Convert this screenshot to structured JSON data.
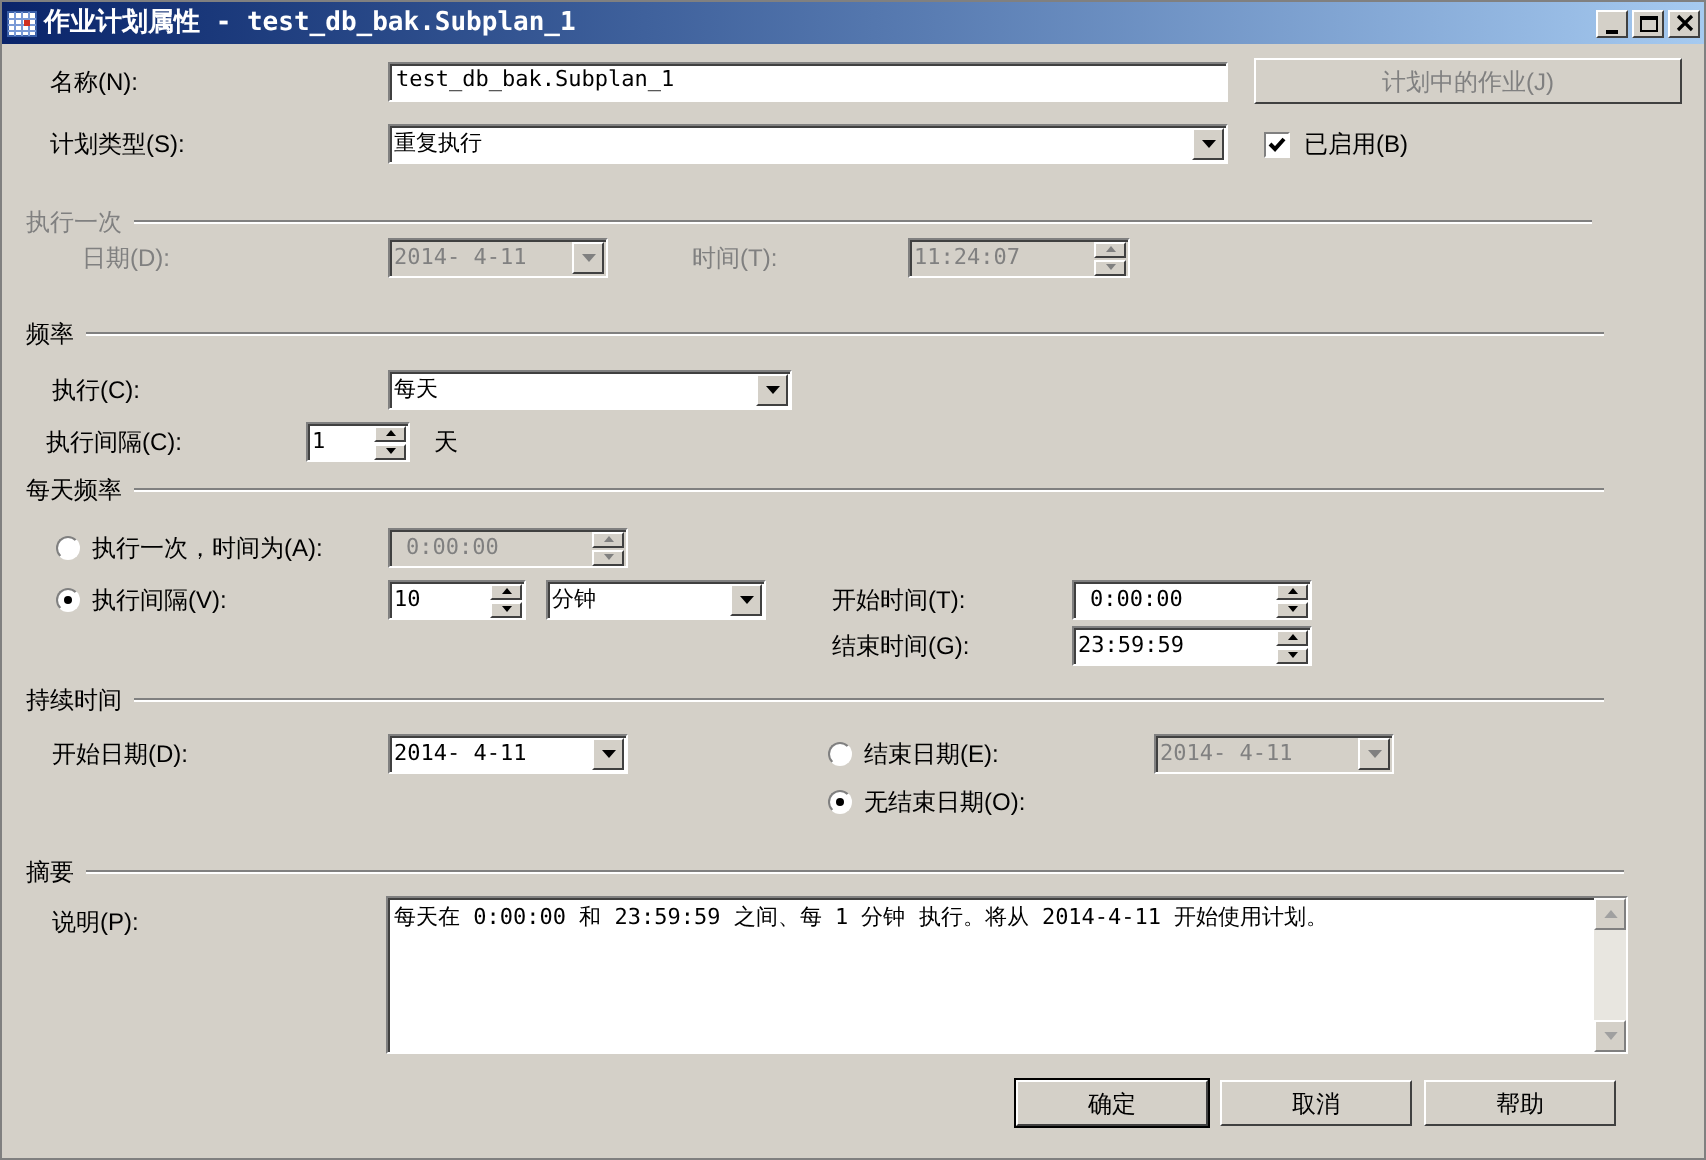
{
  "window": {
    "title": "作业计划属性 - test_db_bak.Subplan_1"
  },
  "name": {
    "label": "名称(N):",
    "value": "test_db_bak.Subplan_1"
  },
  "jobs_button": {
    "label": "计划中的作业(J)",
    "disabled": true
  },
  "schedule_type": {
    "label": "计划类型(S):",
    "value": "重复执行"
  },
  "enabled": {
    "label": "已启用(B)",
    "checked": true
  },
  "one_time": {
    "title": "执行一次",
    "disabled": true,
    "date_label": "日期(D):",
    "date": "2014- 4-11",
    "time_label": "时间(T):",
    "time": "11:24:07"
  },
  "frequency": {
    "title": "频率",
    "occurs_label": "执行(C):",
    "occurs": "每天",
    "recurs_label": "执行间隔(C):",
    "recurs": "1",
    "recurs_unit": "天"
  },
  "daily_frequency": {
    "title": "每天频率",
    "options": [
      {
        "label": "执行一次，时间为(A):",
        "selected": false,
        "time": "0:00:00"
      },
      {
        "label": "执行间隔(V):",
        "selected": true,
        "value": "10",
        "unit": "分钟"
      }
    ],
    "start_label": "开始时间(T):",
    "start": "0:00:00",
    "end_label": "结束时间(G):",
    "end": "23:59:59"
  },
  "duration": {
    "title": "持续时间",
    "start_label": "开始日期(D):",
    "start": "2014- 4-11",
    "end_options": [
      {
        "label": "结束日期(E):",
        "selected": false,
        "date": "2014- 4-11"
      },
      {
        "label": "无结束日期(O):",
        "selected": true
      }
    ]
  },
  "summary": {
    "title": "摘要",
    "label": "说明(P):",
    "text": "每天在 0:00:00 和 23:59:59 之间、每 1 分钟 执行。将从 2014-4-11 开始使用计划。"
  },
  "buttons": [
    {
      "label": "确定",
      "default": true
    },
    {
      "label": "取消",
      "default": false
    },
    {
      "label": "帮助",
      "default": false
    }
  ]
}
